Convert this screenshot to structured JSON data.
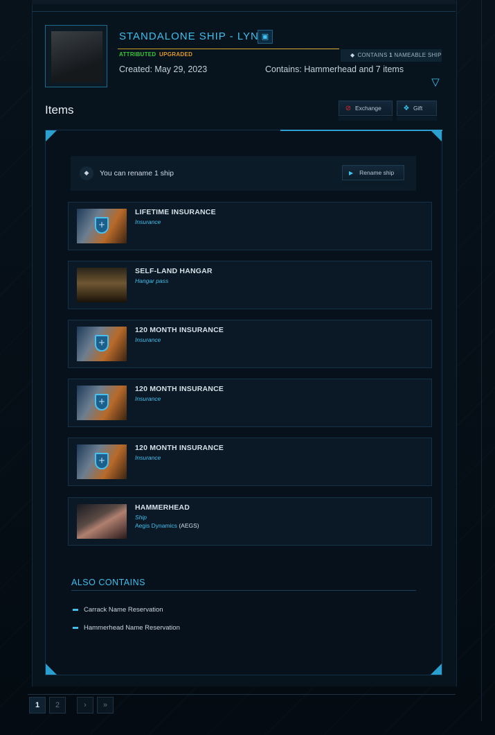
{
  "package": {
    "title": "STANDALONE SHIP - LYNX",
    "attributes": [
      "ATTRIBUTED",
      "UPGRADED"
    ],
    "nameable_count": "1",
    "nameable_prefix": "CONTAINS",
    "nameable_suffix": "NAMEABLE SHIP",
    "created": "Created: May 29, 2023",
    "contains": "Contains: Hammerhead and 7 items"
  },
  "section": {
    "title": "Items",
    "exchange_label": "Exchange",
    "gift_label": "Gift"
  },
  "rename": {
    "text": "You can rename 1 ship",
    "button_label": "Rename ship"
  },
  "items": [
    {
      "name": "LIFETIME INSURANCE",
      "type": "Insurance",
      "thumb": "insurance"
    },
    {
      "name": "SELF-LAND HANGAR",
      "type": "Hangar pass",
      "thumb": "hangar"
    },
    {
      "name": "120 MONTH INSURANCE",
      "type": "Insurance",
      "thumb": "insurance"
    },
    {
      "name": "120 MONTH INSURANCE",
      "type": "Insurance",
      "thumb": "insurance"
    },
    {
      "name": "120 MONTH INSURANCE",
      "type": "Insurance",
      "thumb": "insurance"
    },
    {
      "name": "HAMMERHEAD",
      "type": "Ship",
      "maker": "Aegis Dynamics",
      "maker_code": "(AEGS)",
      "thumb": "ship"
    }
  ],
  "also_contains": {
    "title": "ALSO CONTAINS",
    "items": [
      "Carrack Name Reservation",
      "Hammerhead Name Reservation"
    ]
  },
  "pagination": {
    "pages": [
      "1",
      "2"
    ],
    "current": "1",
    "next": "›",
    "last": "»"
  },
  "icons": {
    "chip": "▣",
    "tag": "◆",
    "collapse": "▽",
    "exchange": "⊘",
    "gift": "❖",
    "play": "▶",
    "shield_cross": "+"
  },
  "colors": {
    "accent": "#3fbfee",
    "attributed": "#38c83a",
    "upgraded": "#e39b2b",
    "title_underline": "#c99a21",
    "exchange_icon": "#e02c2c"
  }
}
